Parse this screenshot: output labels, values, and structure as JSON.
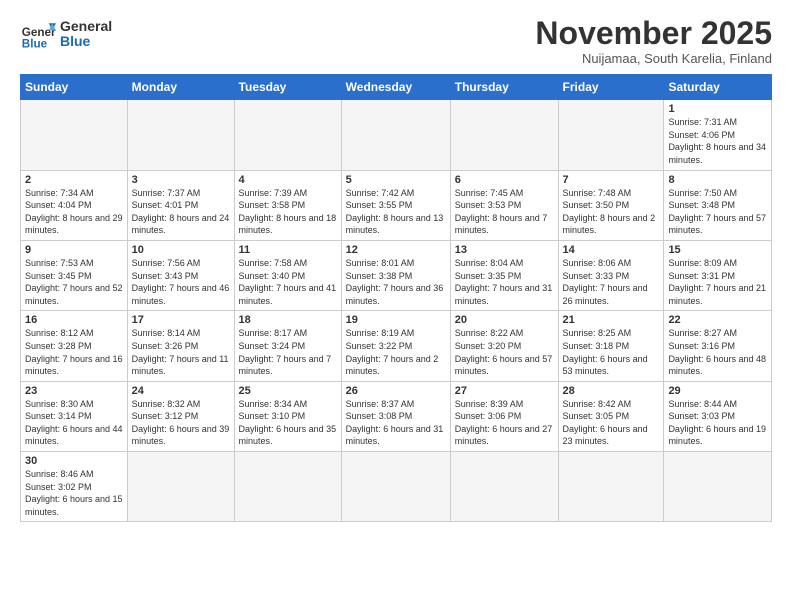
{
  "header": {
    "logo_general": "General",
    "logo_blue": "Blue",
    "month_title": "November 2025",
    "location": "Nuijamaa, South Karelia, Finland"
  },
  "days_of_week": [
    "Sunday",
    "Monday",
    "Tuesday",
    "Wednesday",
    "Thursday",
    "Friday",
    "Saturday"
  ],
  "weeks": [
    [
      {
        "day": "",
        "info": ""
      },
      {
        "day": "",
        "info": ""
      },
      {
        "day": "",
        "info": ""
      },
      {
        "day": "",
        "info": ""
      },
      {
        "day": "",
        "info": ""
      },
      {
        "day": "",
        "info": ""
      },
      {
        "day": "1",
        "info": "Sunrise: 7:31 AM\nSunset: 4:06 PM\nDaylight: 8 hours and 34 minutes."
      }
    ],
    [
      {
        "day": "2",
        "info": "Sunrise: 7:34 AM\nSunset: 4:04 PM\nDaylight: 8 hours and 29 minutes."
      },
      {
        "day": "3",
        "info": "Sunrise: 7:37 AM\nSunset: 4:01 PM\nDaylight: 8 hours and 24 minutes."
      },
      {
        "day": "4",
        "info": "Sunrise: 7:39 AM\nSunset: 3:58 PM\nDaylight: 8 hours and 18 minutes."
      },
      {
        "day": "5",
        "info": "Sunrise: 7:42 AM\nSunset: 3:55 PM\nDaylight: 8 hours and 13 minutes."
      },
      {
        "day": "6",
        "info": "Sunrise: 7:45 AM\nSunset: 3:53 PM\nDaylight: 8 hours and 7 minutes."
      },
      {
        "day": "7",
        "info": "Sunrise: 7:48 AM\nSunset: 3:50 PM\nDaylight: 8 hours and 2 minutes."
      },
      {
        "day": "8",
        "info": "Sunrise: 7:50 AM\nSunset: 3:48 PM\nDaylight: 7 hours and 57 minutes."
      }
    ],
    [
      {
        "day": "9",
        "info": "Sunrise: 7:53 AM\nSunset: 3:45 PM\nDaylight: 7 hours and 52 minutes."
      },
      {
        "day": "10",
        "info": "Sunrise: 7:56 AM\nSunset: 3:43 PM\nDaylight: 7 hours and 46 minutes."
      },
      {
        "day": "11",
        "info": "Sunrise: 7:58 AM\nSunset: 3:40 PM\nDaylight: 7 hours and 41 minutes."
      },
      {
        "day": "12",
        "info": "Sunrise: 8:01 AM\nSunset: 3:38 PM\nDaylight: 7 hours and 36 minutes."
      },
      {
        "day": "13",
        "info": "Sunrise: 8:04 AM\nSunset: 3:35 PM\nDaylight: 7 hours and 31 minutes."
      },
      {
        "day": "14",
        "info": "Sunrise: 8:06 AM\nSunset: 3:33 PM\nDaylight: 7 hours and 26 minutes."
      },
      {
        "day": "15",
        "info": "Sunrise: 8:09 AM\nSunset: 3:31 PM\nDaylight: 7 hours and 21 minutes."
      }
    ],
    [
      {
        "day": "16",
        "info": "Sunrise: 8:12 AM\nSunset: 3:28 PM\nDaylight: 7 hours and 16 minutes."
      },
      {
        "day": "17",
        "info": "Sunrise: 8:14 AM\nSunset: 3:26 PM\nDaylight: 7 hours and 11 minutes."
      },
      {
        "day": "18",
        "info": "Sunrise: 8:17 AM\nSunset: 3:24 PM\nDaylight: 7 hours and 7 minutes."
      },
      {
        "day": "19",
        "info": "Sunrise: 8:19 AM\nSunset: 3:22 PM\nDaylight: 7 hours and 2 minutes."
      },
      {
        "day": "20",
        "info": "Sunrise: 8:22 AM\nSunset: 3:20 PM\nDaylight: 6 hours and 57 minutes."
      },
      {
        "day": "21",
        "info": "Sunrise: 8:25 AM\nSunset: 3:18 PM\nDaylight: 6 hours and 53 minutes."
      },
      {
        "day": "22",
        "info": "Sunrise: 8:27 AM\nSunset: 3:16 PM\nDaylight: 6 hours and 48 minutes."
      }
    ],
    [
      {
        "day": "23",
        "info": "Sunrise: 8:30 AM\nSunset: 3:14 PM\nDaylight: 6 hours and 44 minutes."
      },
      {
        "day": "24",
        "info": "Sunrise: 8:32 AM\nSunset: 3:12 PM\nDaylight: 6 hours and 39 minutes."
      },
      {
        "day": "25",
        "info": "Sunrise: 8:34 AM\nSunset: 3:10 PM\nDaylight: 6 hours and 35 minutes."
      },
      {
        "day": "26",
        "info": "Sunrise: 8:37 AM\nSunset: 3:08 PM\nDaylight: 6 hours and 31 minutes."
      },
      {
        "day": "27",
        "info": "Sunrise: 8:39 AM\nSunset: 3:06 PM\nDaylight: 6 hours and 27 minutes."
      },
      {
        "day": "28",
        "info": "Sunrise: 8:42 AM\nSunset: 3:05 PM\nDaylight: 6 hours and 23 minutes."
      },
      {
        "day": "29",
        "info": "Sunrise: 8:44 AM\nSunset: 3:03 PM\nDaylight: 6 hours and 19 minutes."
      }
    ],
    [
      {
        "day": "30",
        "info": "Sunrise: 8:46 AM\nSunset: 3:02 PM\nDaylight: 6 hours and 15 minutes."
      },
      {
        "day": "",
        "info": ""
      },
      {
        "day": "",
        "info": ""
      },
      {
        "day": "",
        "info": ""
      },
      {
        "day": "",
        "info": ""
      },
      {
        "day": "",
        "info": ""
      },
      {
        "day": "",
        "info": ""
      }
    ]
  ]
}
